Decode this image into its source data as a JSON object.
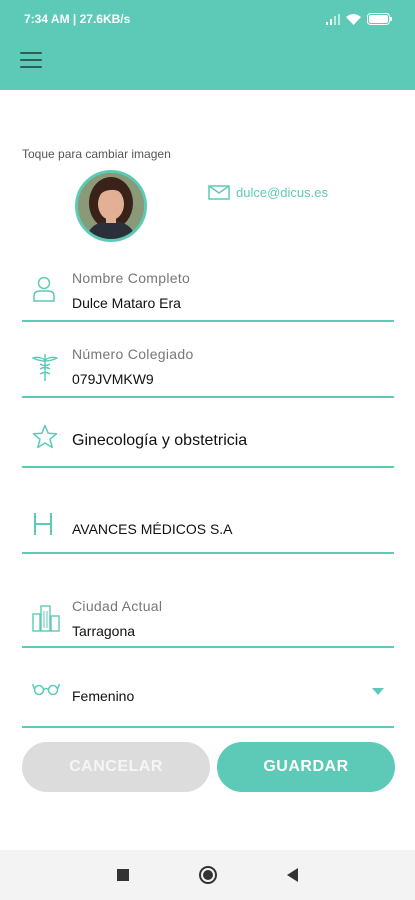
{
  "status_bar": {
    "time_speed": "7:34 AM | 27.6KB/s",
    "battery": "98"
  },
  "header": {
    "menu_icon": "hamburger-menu-icon"
  },
  "profile": {
    "change_image_label": "Toque para cambiar imagen",
    "email": "dulce@dicus.es"
  },
  "fields": {
    "full_name": {
      "label": "Nombre Completo",
      "value": "Dulce Mataro Era"
    },
    "license_number": {
      "label": "Número Colegiado",
      "value": "079JVMKW9"
    },
    "specialty": {
      "value": "Ginecología y obstetricia"
    },
    "hospital": {
      "value": "AVANCES MÉDICOS S.A"
    },
    "city": {
      "label": "Ciudad Actual",
      "value": "Tarragona"
    },
    "gender": {
      "value": "Femenino"
    }
  },
  "buttons": {
    "cancel": "CANCELAR",
    "save": "GUARDAR"
  },
  "colors": {
    "accent": "#5dcab7",
    "cancel_bg": "#dcdcdc"
  }
}
